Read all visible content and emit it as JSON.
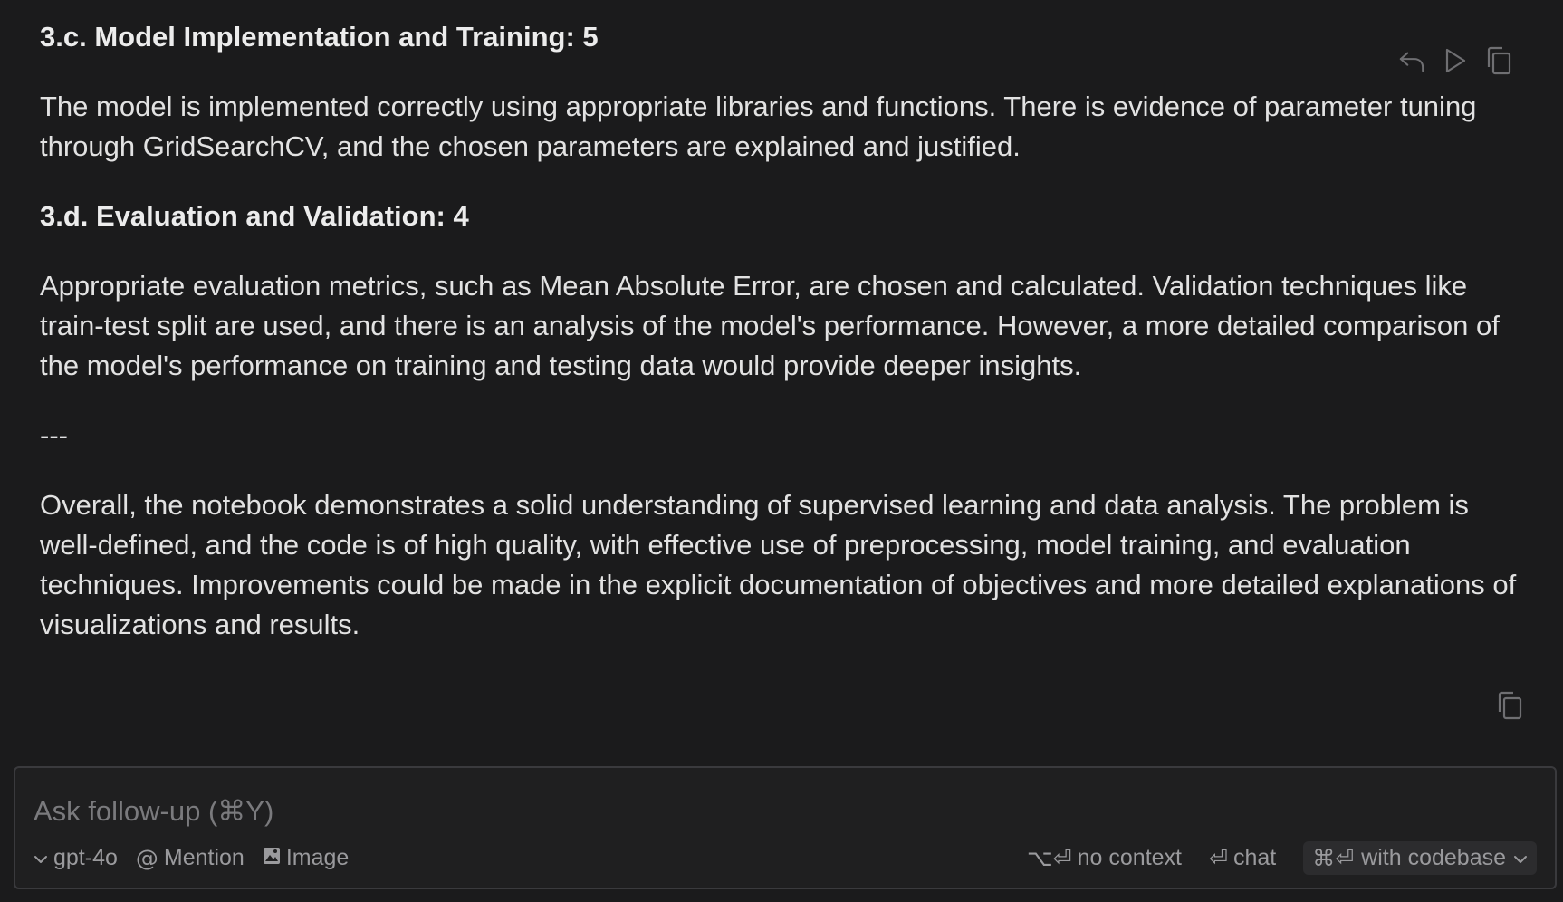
{
  "message": {
    "sections": [
      {
        "heading": "3.c. Model Implementation and Training: 5",
        "body": "The model is implemented correctly using appropriate libraries and functions. There is evidence of parameter tuning through GridSearchCV, and the chosen parameters are explained and justified."
      },
      {
        "heading": "3.d. Evaluation and Validation: 4",
        "body": "Appropriate evaluation metrics, such as Mean Absolute Error, are chosen and calculated. Validation techniques like train-test split are used, and there is an analysis of the model's performance. However, a more detailed comparison of the model's performance on training and testing data would provide deeper insights."
      }
    ],
    "separator": "---",
    "summary": "Overall, the notebook demonstrates a solid understanding of supervised learning and data analysis. The problem is well-defined, and the code is of high quality, with effective use of preprocessing, model training, and evaluation techniques. Improvements could be made in the explicit documentation of objectives and more detailed explanations of visualizations and results."
  },
  "actions": {
    "icons": [
      "undo-icon",
      "play-icon",
      "copy-icon"
    ]
  },
  "composer": {
    "placeholder": "Ask follow-up (⌘Y)",
    "model_label": "gpt-4o",
    "mention_label": "Mention",
    "image_label": "Image",
    "no_context_shortcut": "⌥⏎",
    "no_context_label": "no context",
    "chat_shortcut": "⏎",
    "chat_label": "chat",
    "codebase_shortcut": "⌘⏎",
    "codebase_label": "with codebase"
  }
}
